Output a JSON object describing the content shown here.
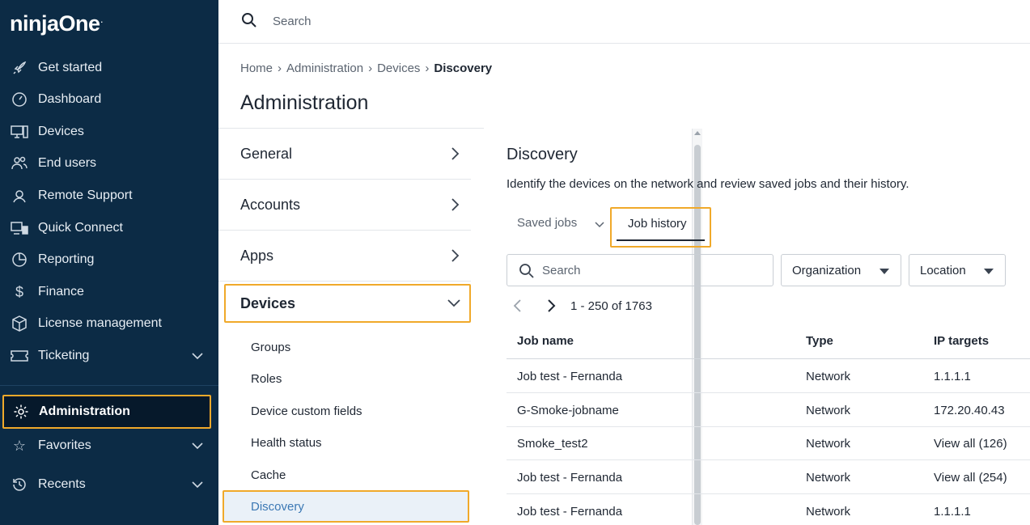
{
  "sidebar": {
    "logo": "ninjaOne",
    "logo_mark": ".",
    "items": [
      {
        "label": "Get started",
        "icon": "rocket-icon"
      },
      {
        "label": "Dashboard",
        "icon": "gauge-icon"
      },
      {
        "label": "Devices",
        "icon": "monitor-icon"
      },
      {
        "label": "End users",
        "icon": "users-icon"
      },
      {
        "label": "Remote Support",
        "icon": "headset-icon"
      },
      {
        "label": "Quick Connect",
        "icon": "quick-connect-icon"
      },
      {
        "label": "Reporting",
        "icon": "pie-chart-icon"
      },
      {
        "label": "Finance",
        "icon": "dollar-icon"
      },
      {
        "label": "License management",
        "icon": "package-icon"
      },
      {
        "label": "Ticketing",
        "icon": "ticket-icon"
      }
    ],
    "administration": "Administration",
    "favorites": "Favorites",
    "recents": "Recents"
  },
  "topbar": {
    "search_placeholder": "Search"
  },
  "breadcrumb": [
    "Home",
    "Administration",
    "Devices",
    "Discovery"
  ],
  "page_title": "Administration",
  "menu": {
    "sections": [
      "General",
      "Accounts",
      "Apps"
    ],
    "devices": "Devices",
    "sub_items": [
      "Groups",
      "Roles",
      "Device custom fields",
      "Health status",
      "Cache"
    ],
    "discovery": "Discovery"
  },
  "content": {
    "title": "Discovery",
    "description": "Identify the devices on the network and review saved jobs and their history.",
    "tabs": {
      "saved_jobs": "Saved jobs",
      "job_history": "Job history"
    },
    "filters": {
      "search_placeholder": "Search",
      "organization": "Organization",
      "location": "Location"
    },
    "pager": "1 - 250 of 1763",
    "table": {
      "headers": [
        "Job name",
        "Type",
        "IP targets"
      ],
      "rows": [
        [
          "Job test - Fernanda",
          "Network",
          "1.1.1.1"
        ],
        [
          "G-Smoke-jobname",
          "Network",
          "172.20.40.43"
        ],
        [
          "Smoke_test2",
          "Network",
          "View all (126)"
        ],
        [
          "Job test - Fernanda",
          "Network",
          "View all (254)"
        ],
        [
          "Job test - Fernanda",
          "Network",
          "1.1.1.1"
        ]
      ]
    }
  },
  "colors": {
    "sidebar_bg": "#0c2b45",
    "highlight": "#f0a92a",
    "link": "#3b78b4"
  }
}
